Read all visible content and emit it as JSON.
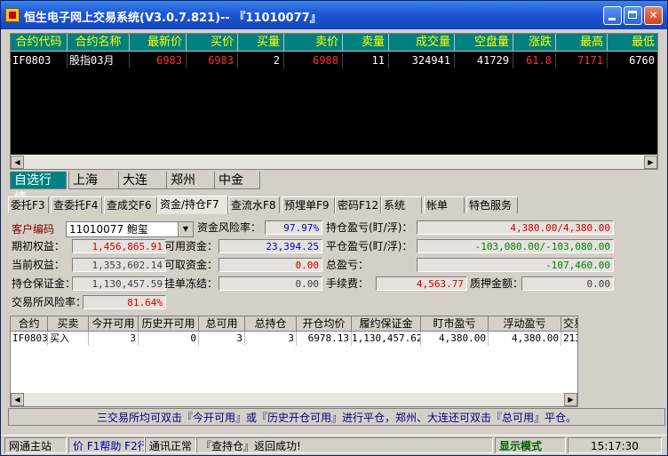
{
  "window": {
    "title": "恒生电子网上交易系统(V3.0.7.821)-- 『11010077』",
    "controls": [
      "minimize-icon",
      "maximize-icon",
      "close-icon"
    ]
  },
  "quote_table": {
    "headers": [
      "合约代码",
      "合约名称",
      "最新价",
      "买价",
      "买量",
      "卖价",
      "卖量",
      "成交量",
      "空盘量",
      "涨跌",
      "最高",
      "最低"
    ],
    "rows": [
      [
        "IF0803",
        "股指03月",
        "6983",
        "6983",
        "2",
        "6988",
        "11",
        "324941",
        "41729",
        "61.8",
        "7171",
        "6760"
      ]
    ]
  },
  "market_tabs": [
    "自选行情",
    "上海",
    "大连",
    "郑州",
    "中金"
  ],
  "function_tabs": [
    "委托F3",
    "查委托F4",
    "查成交F6",
    "资金/持仓F7",
    "查流水F8",
    "预埋单F9",
    "密码F12",
    "系统",
    "帐单",
    "特色服务"
  ],
  "account": {
    "customer_label": "客户编码",
    "customer_value": "11010077 鲍玺",
    "fund_risk_label": "资金风险率：",
    "fund_risk_value": "97.97%",
    "pos_pl_label": "持仓盈亏(盯/浮)：",
    "pos_pl_value": "4,380.00/4,380.00",
    "init_equity_label": "期初权益：",
    "init_equity_value": "1,456,865.91",
    "avail_label": "可用资金：",
    "avail_value": "23,394.25",
    "close_pl_label": "平仓盈亏(盯/浮)：",
    "close_pl_value": "-103,080.00/-103,080.00",
    "cur_equity_label": "当前权益：",
    "cur_equity_value": "1,353,602.14",
    "withdraw_label": "可取资金：",
    "withdraw_value": "0.00",
    "total_pl_label": "总盈亏：",
    "total_pl_value": "-107,460.00",
    "margin_label": "持仓保证金：",
    "margin_value": "1,130,457.59",
    "frozen_label": "挂单冻结：",
    "frozen_value": "0.00",
    "fee_label": "手续费：",
    "fee_value": "4,563.77",
    "pledge_label": "质押金额：",
    "pledge_value": "0.00",
    "exch_risk_label": "交易所风险率：",
    "exch_risk_value": "81.64%"
  },
  "positions": {
    "headers": [
      "合约",
      "买卖",
      "今开可用",
      "历史开可用",
      "总可用",
      "总持仓",
      "开仓均价",
      "履约保证金",
      "盯市盈亏",
      "浮动盈亏",
      "交易"
    ],
    "rows": [
      [
        "IF0803",
        "买入",
        "3",
        "0",
        "3",
        "3",
        "6978.13",
        "1,130,457.62",
        "4,380.00",
        "4,380.00",
        "213"
      ]
    ]
  },
  "hint_text": "三交易所均可双击『今开可用』或『历史开仓可用』进行平仓，郑州、大连还可双击『总可用』平仓。",
  "status_bar": {
    "server": "网通主站",
    "help": "价 F1帮助 F2行",
    "conn": "通讯正常",
    "message": "『查持仓』返回成功!",
    "mode": "显示模式",
    "time": "15:17:30"
  }
}
